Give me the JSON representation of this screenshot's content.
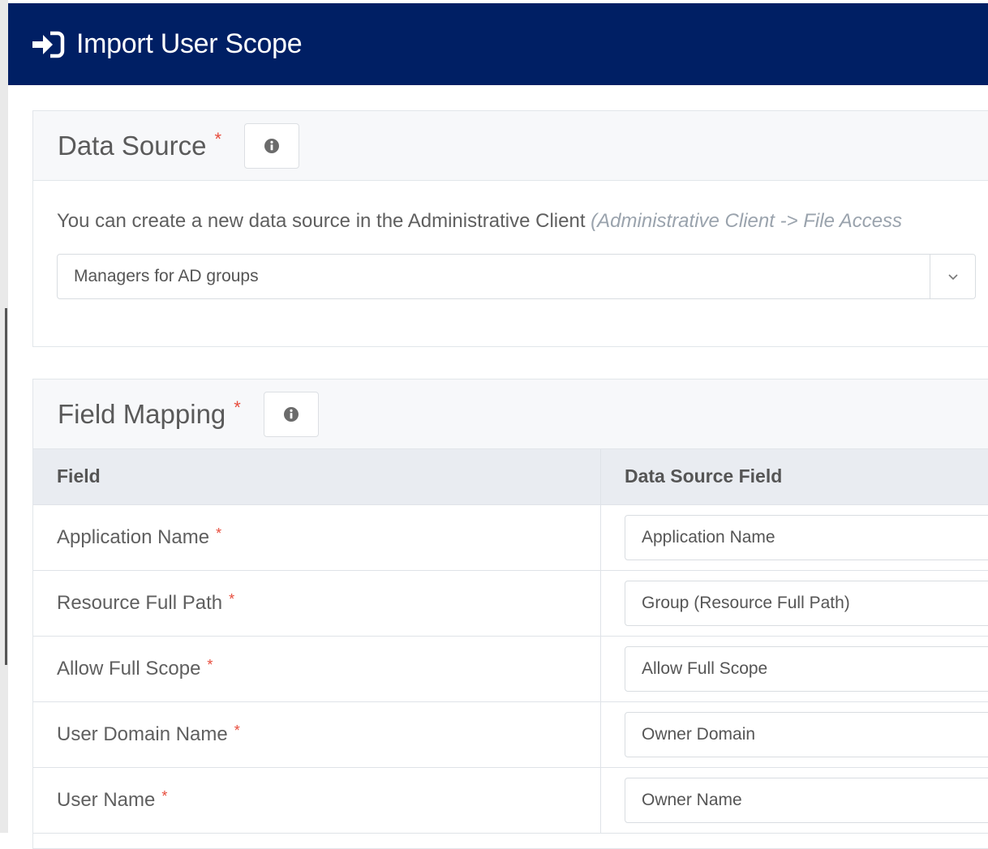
{
  "window": {
    "title": "Import User Scope",
    "icon": "sign-in-icon"
  },
  "colors": {
    "titlebar": "#001f64",
    "required": "#e74c3c"
  },
  "data_source": {
    "title": "Data Source",
    "required_mark": "*",
    "info_icon": "info-circle-icon",
    "hint_text": "You can create a new data source in the Administrative Client ",
    "hint_path": "(Administrative Client -> File Access",
    "selected": "Managers for AD groups"
  },
  "field_mapping": {
    "title": "Field Mapping",
    "required_mark": "*",
    "info_icon": "info-circle-icon",
    "columns": {
      "field": "Field",
      "data_source_field": "Data Source Field"
    },
    "rows": [
      {
        "field": "Application Name",
        "required": "*",
        "value": "Application Name"
      },
      {
        "field": "Resource Full Path",
        "required": "*",
        "value": "Group (Resource Full Path)"
      },
      {
        "field": "Allow Full Scope",
        "required": "*",
        "value": "Allow Full Scope"
      },
      {
        "field": "User Domain Name",
        "required": "*",
        "value": "Owner Domain"
      },
      {
        "field": "User Name",
        "required": "*",
        "value": "Owner Name"
      }
    ]
  }
}
